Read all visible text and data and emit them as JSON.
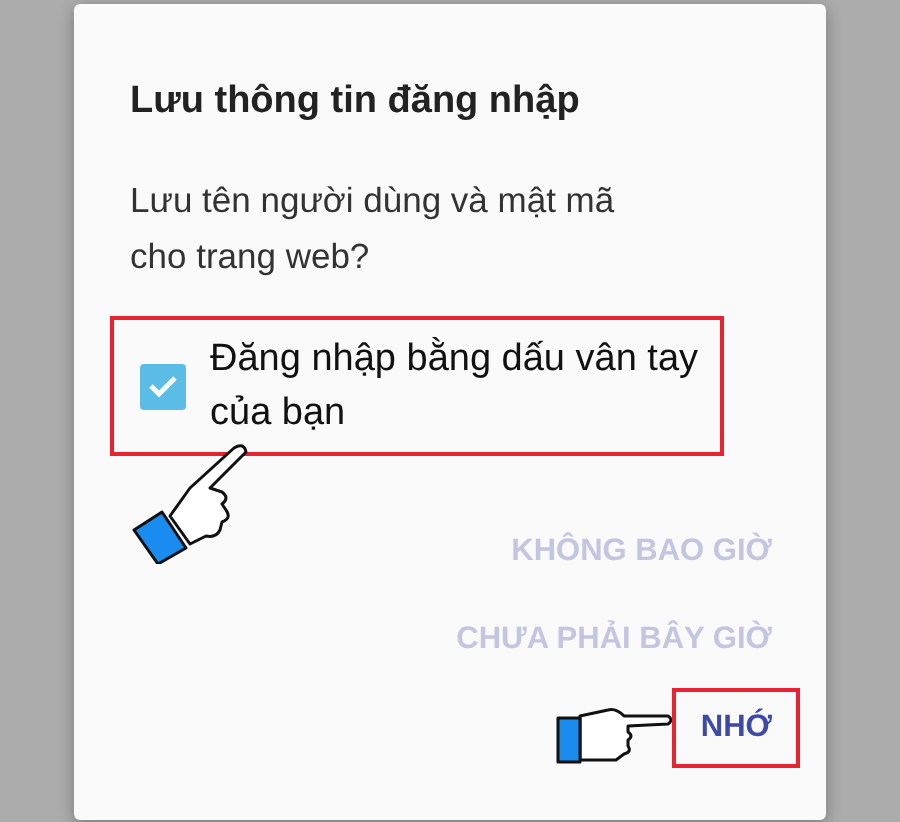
{
  "dialog": {
    "title": "Lưu thông tin đăng nhập",
    "message": "Lưu tên người dùng và mật mã cho trang web?",
    "checkbox": {
      "label": "Đăng nhập bằng dấu vân tay của bạn",
      "checked": true,
      "highlighted": true,
      "pointer": true
    },
    "buttons": [
      {
        "label": "KHÔNG BAO GIỜ",
        "disabled": true,
        "highlighted": false,
        "pointer": false
      },
      {
        "label": "CHƯA PHẢI BÂY GIỜ",
        "disabled": true,
        "highlighted": false,
        "pointer": false
      },
      {
        "label": "NHỚ",
        "disabled": false,
        "highlighted": true,
        "pointer": true
      }
    ]
  }
}
